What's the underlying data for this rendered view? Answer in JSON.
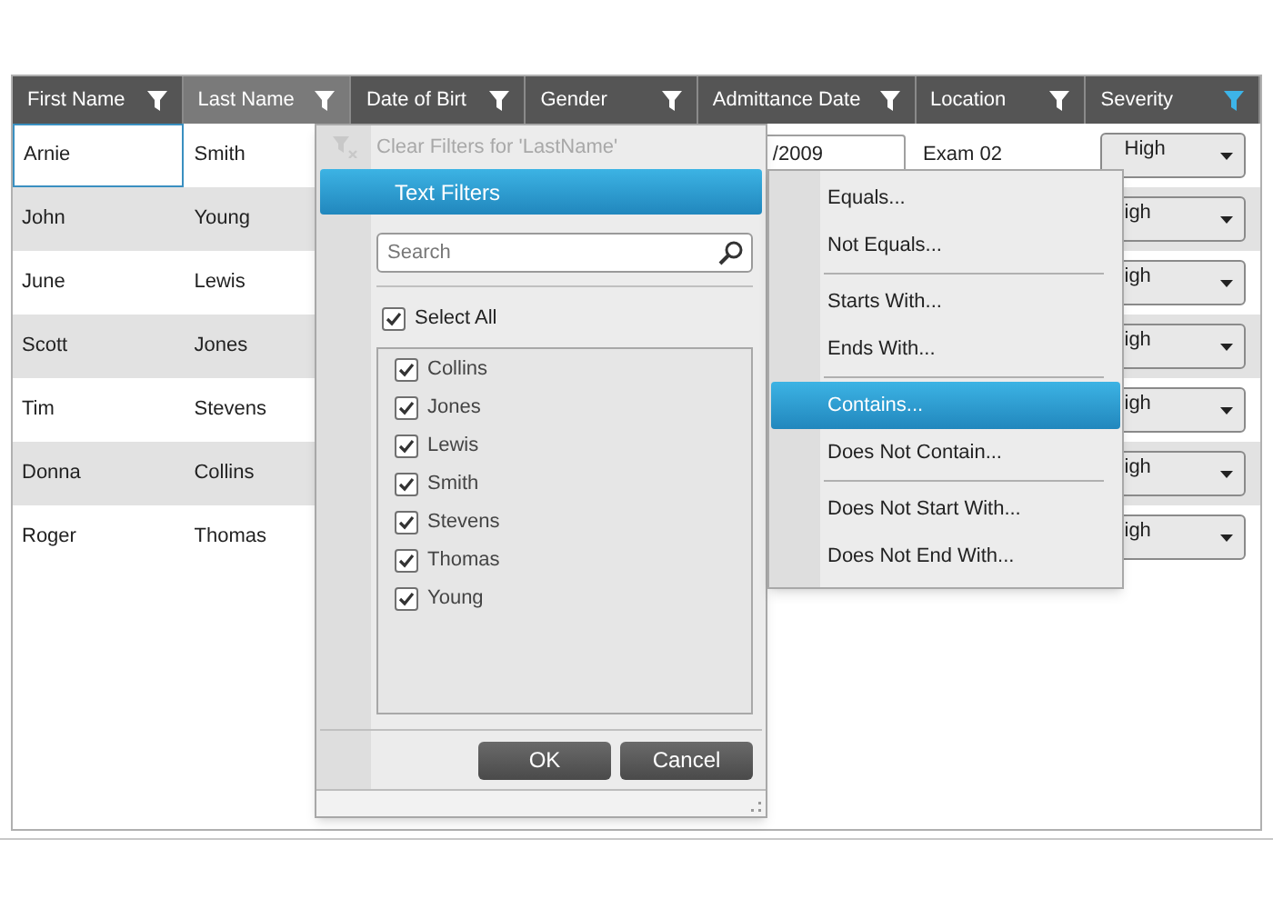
{
  "grid": {
    "columns": [
      {
        "label": "First Name",
        "selected": false,
        "filter_active": false
      },
      {
        "label": "Last Name",
        "selected": true,
        "filter_active": false
      },
      {
        "label": "Date of Birt",
        "selected": false,
        "filter_active": false
      },
      {
        "label": "Gender",
        "selected": false,
        "filter_active": false
      },
      {
        "label": "Admittance Date",
        "selected": false,
        "filter_active": false
      },
      {
        "label": "Location",
        "selected": false,
        "filter_active": false
      },
      {
        "label": "Severity",
        "selected": false,
        "filter_active": true
      }
    ],
    "rows": [
      {
        "first_name": "Arnie",
        "last_name": "Smith",
        "admittance_date": "/2009",
        "location": "Exam 02",
        "severity": "High",
        "current": true
      },
      {
        "first_name": "John",
        "last_name": "Young",
        "severity": "igh",
        "current": false
      },
      {
        "first_name": "June",
        "last_name": "Lewis",
        "severity": "igh",
        "current": false
      },
      {
        "first_name": "Scott",
        "last_name": "Jones",
        "severity": "igh",
        "current": false
      },
      {
        "first_name": "Tim",
        "last_name": "Stevens",
        "severity": "igh",
        "current": false
      },
      {
        "first_name": "Donna",
        "last_name": "Collins",
        "severity": "igh",
        "current": false
      },
      {
        "first_name": "Roger",
        "last_name": "Thomas",
        "severity": "igh",
        "current": false
      }
    ]
  },
  "filter_popup": {
    "clear_filters": {
      "label": "Clear Filters for 'LastName'",
      "disabled": true
    },
    "text_filters": {
      "label": "Text Filters",
      "selected": true
    },
    "search": {
      "placeholder": "Search"
    },
    "select_all": {
      "label": "Select All",
      "checked": true
    },
    "values": [
      {
        "label": "Collins",
        "checked": true
      },
      {
        "label": "Jones",
        "checked": true
      },
      {
        "label": "Lewis",
        "checked": true
      },
      {
        "label": "Smith",
        "checked": true
      },
      {
        "label": "Stevens",
        "checked": true
      },
      {
        "label": "Thomas",
        "checked": true
      },
      {
        "label": "Young",
        "checked": true
      }
    ],
    "buttons": [
      "OK",
      "Cancel"
    ]
  },
  "text_filter_menu": [
    {
      "kind": "item",
      "label": "Equals...",
      "selected": false
    },
    {
      "kind": "item",
      "label": "Not Equals...",
      "selected": false
    },
    {
      "kind": "separator"
    },
    {
      "kind": "item",
      "label": "Starts With...",
      "selected": false
    },
    {
      "kind": "item",
      "label": "Ends With...",
      "selected": false
    },
    {
      "kind": "separator"
    },
    {
      "kind": "item",
      "label": "Contains...",
      "selected": true
    },
    {
      "kind": "item",
      "label": "Does Not Contain...",
      "selected": false
    },
    {
      "kind": "separator"
    },
    {
      "kind": "item",
      "label": "Does Not Start With...",
      "selected": false
    },
    {
      "kind": "item",
      "label": "Does Not End With...",
      "selected": false
    }
  ]
}
